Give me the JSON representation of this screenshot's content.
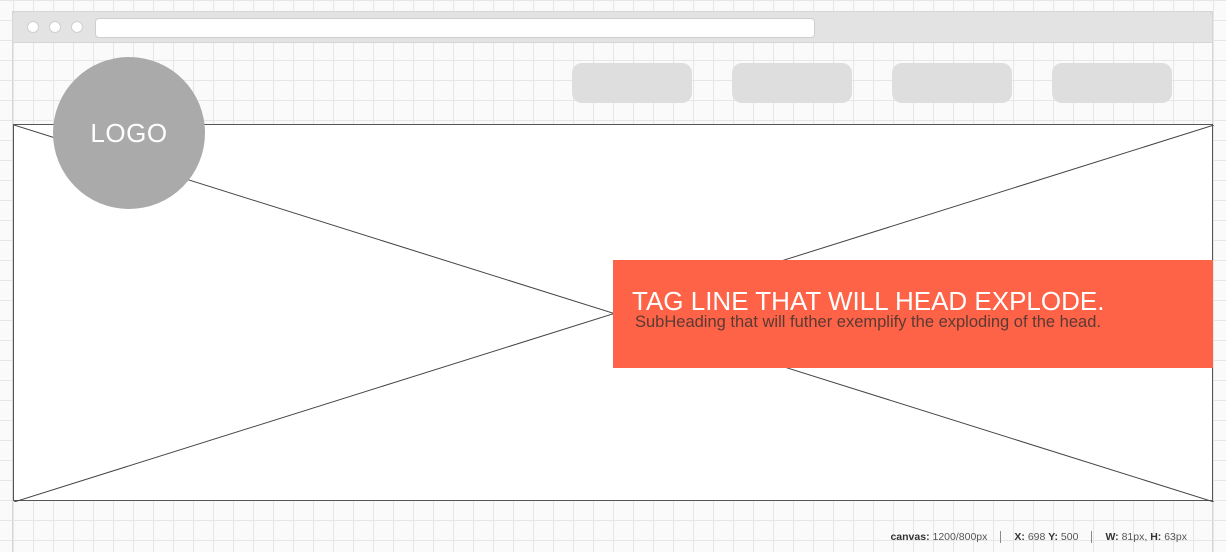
{
  "window": {
    "traffic_lights": [
      "close",
      "minimize",
      "maximize"
    ]
  },
  "nav": {
    "items": [
      "",
      "",
      "",
      ""
    ]
  },
  "logo": {
    "label": "LOGO",
    "color": "#aaaaaa"
  },
  "hero": {
    "image_placeholder": "image-placeholder-icon",
    "tagline": "TAG LINE THAT WILL HEAD EXPLODE.",
    "subheading": "SubHeading that will futher exemplify the exploding of the head.",
    "accent_color": "#ff6347"
  },
  "status": {
    "canvas_label": "canvas:",
    "canvas_value": "1200/800px",
    "x_label": "X:",
    "x_value": "698",
    "y_label": "Y:",
    "y_value": "500",
    "w_label": "W:",
    "w_value": "81px,",
    "h_label": "H:",
    "h_value": "63px"
  }
}
